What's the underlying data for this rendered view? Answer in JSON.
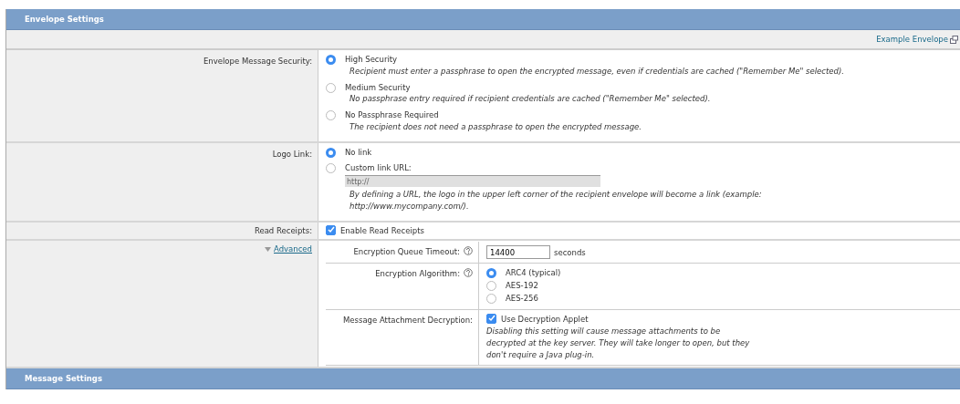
{
  "section_title": "Envelope Settings",
  "example_link": "Example Envelope",
  "rows": [
    {
      "kind": "radio",
      "label": "Envelope Message Security:",
      "options": [
        {
          "label": "High Security",
          "description": "Recipient must enter a passphrase to open the encrypted message, even if credentials are cached (\"Remember Me\" selected).",
          "selected": true
        },
        {
          "label": "Medium Security",
          "description": "No passphrase entry required if recipient credentials are cached (\"Remember Me\" selected).",
          "selected": false
        },
        {
          "label": "No Passphrase Required",
          "description": "The recipient does not need a passphrase to open the encrypted message.",
          "selected": false
        }
      ]
    },
    {
      "kind": "radio",
      "label": "Logo Link:",
      "options": [
        {
          "label": "No link",
          "selected": true
        },
        {
          "label": "Custom link URL:",
          "selected": false,
          "field": {
            "value": "http://",
            "disabled": true
          },
          "description": "By defining a URL, the logo in the upper left corner of the recipient envelope will become a link (example: http://www.mycompany.com/)."
        }
      ]
    },
    {
      "kind": "checkbox",
      "label": "Read Receipts:",
      "option": {
        "label": "Enable Read Receipts",
        "checked": true
      }
    },
    {
      "kind": "advanced",
      "label": "Advanced",
      "expanded": true,
      "settings": [
        {
          "kind": "text",
          "label": "Encryption Queue Timeout:",
          "help": true,
          "value": "14400",
          "unit": "seconds"
        },
        {
          "kind": "radio",
          "label": "Encryption Algorithm:",
          "help": true,
          "options": [
            {
              "label": "ARC4 (typical)",
              "selected": true
            },
            {
              "label": "AES-192",
              "selected": false
            },
            {
              "label": "AES-256",
              "selected": false
            }
          ]
        },
        {
          "kind": "checkbox",
          "label": "Message Attachment Decryption:",
          "option": {
            "label": "Use Decryption Applet",
            "checked": true,
            "description": "Disabling this setting will cause message attachments to be decrypted at the key server. They will take longer to open, but they don't require a Java plug-in."
          }
        }
      ]
    }
  ],
  "next_section_title": "Message Settings"
}
